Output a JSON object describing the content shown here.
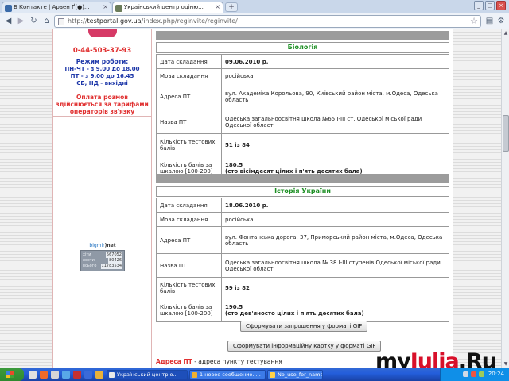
{
  "browser": {
    "tabs": [
      {
        "title": "В Контакте | Арвен Ґ(●)...",
        "favicon_color": "#3a6aa8"
      },
      {
        "title": "Український центр оціню...",
        "favicon_color": "#6b7c5a"
      }
    ],
    "new_tab": "+",
    "window_controls": {
      "minimize": "_",
      "maximize": "□",
      "close": "×"
    },
    "url_prefix": "http://",
    "url_host": "testportal.gov.ua",
    "url_path": "/index.php/reginvite/reginvite/"
  },
  "sidebar": {
    "phone": "0-44-503-37-93",
    "hours_title": "Режим роботи:",
    "hours": [
      "ПН-ЧТ - з 9.00 до 18.00",
      "ПТ - з 9.00 до 16.45",
      "СБ, НД - вихідні"
    ],
    "payment_note": [
      "Оплата розмов",
      "здійснюється за тарифами",
      "операторів зв'язку"
    ],
    "counter": {
      "brand_a": "bigmir",
      "brand_b": ")net",
      "rows": [
        {
          "label": "хіти",
          "value": "567052"
        },
        {
          "label": "хости",
          "value": "80426"
        },
        {
          "label": "всього",
          "value": "11783534"
        }
      ]
    }
  },
  "labels": {
    "date": "Дата складання",
    "language": "Мова складання",
    "address": "Адреса ПТ",
    "name": "Назва ПТ",
    "test_points": "Кількість тестових балів",
    "scale_points": "Кількість балів за шкалою [100-200]"
  },
  "exams": [
    {
      "subject": "Біологія",
      "date": "09.06.2010 р.",
      "language": "російська",
      "address": "вул. Академіка Корольова, 90, Київський район міста, м.Одеса, Одеська область",
      "name": "Одеська загальноосвітня школа №65 І-ІІІ ст. Одеської міської ради Одеської області",
      "test_points": "51 із 84",
      "scale_points": "180.5",
      "scale_words": "(сто вісімдесят цілих і п'ять десятих бала)"
    },
    {
      "subject": "Історія України",
      "date": "18.06.2010 р.",
      "language": "російська",
      "address": "вул. Фонтанська дорога, 37, Приморський район міста, м.Одеса, Одеська область",
      "name": "Одеська загальноосвітня школа № 38 І-ІІІ ступенів Одеської міської ради Одеської області",
      "test_points": "59 із 82",
      "scale_points": "190.5",
      "scale_words": "(сто дев'яносто цілих і п'ять десятих бала)"
    }
  ],
  "buttons": {
    "gif_invite": "Сформувати запрошення у форматі GIF",
    "gif_card": "Сформувати інформаційну картку у форматі GIF"
  },
  "footnote": {
    "term": "Адреса ПТ",
    "text": " - адреса пункту тестування"
  },
  "taskbar": {
    "tasks": [
      {
        "label": "Український центр о...",
        "icon_color": "#e9e9e9"
      },
      {
        "label": "1 новое сообщение. ...",
        "icon_color": "#f0b030"
      },
      {
        "label": "No_use_for_name",
        "icon_color": "#ffd24a"
      }
    ],
    "clock": "20:24"
  },
  "watermark": {
    "prefix": "my",
    "brand": "Julia",
    "suffix": ".Ru"
  }
}
